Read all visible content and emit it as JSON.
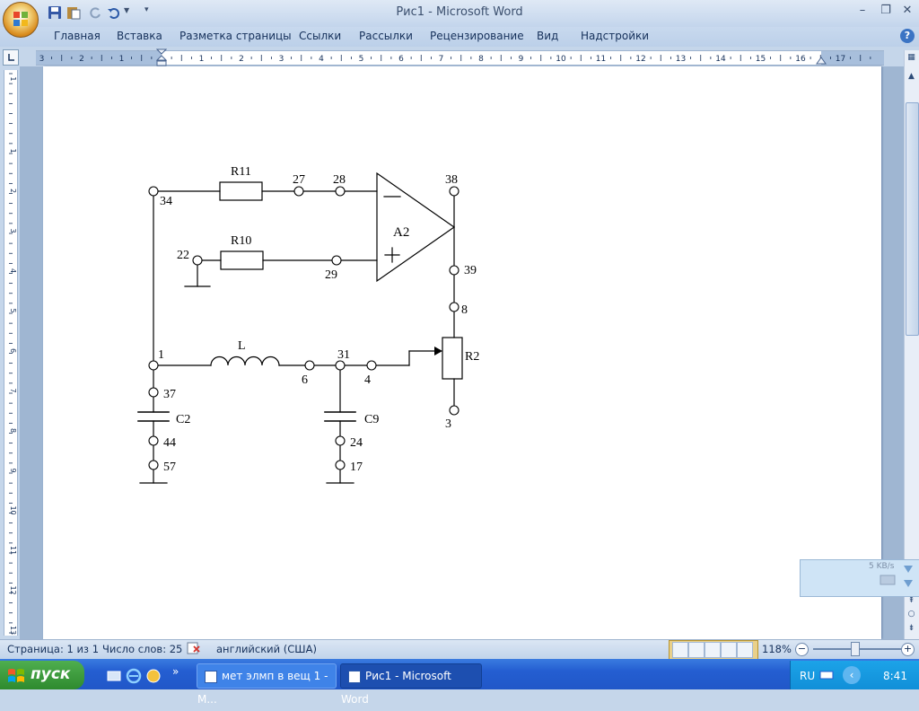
{
  "window": {
    "title": "Рис1 - Microsoft Word"
  },
  "ribbon": {
    "tabs": [
      "Главная",
      "Вставка",
      "Разметка страницы",
      "Ссылки",
      "Рассылки",
      "Рецензирование",
      "Вид",
      "Надстройки"
    ]
  },
  "ruler": {
    "horizontal_numbers": [
      "3",
      "2",
      "1",
      "1",
      "2",
      "3",
      "4",
      "5",
      "6",
      "7",
      "8",
      "9",
      "10",
      "11",
      "12",
      "13",
      "14",
      "15",
      "16",
      "17"
    ],
    "vertical_numbers": [
      "1",
      "1",
      "2",
      "3",
      "4",
      "5",
      "6",
      "7",
      "8",
      "9",
      "10",
      "11",
      "12",
      "13"
    ]
  },
  "diagram": {
    "resistors": [
      "R11",
      "R10",
      "R2"
    ],
    "inductor": "L",
    "capacitors": [
      "C2",
      "C9"
    ],
    "opamp_label": "A2",
    "opamp_inputs": [
      "—",
      "+"
    ],
    "nodes": [
      "34",
      "27",
      "28",
      "38",
      "22",
      "29",
      "39",
      "8",
      "1",
      "6",
      "31",
      "4",
      "3",
      "37",
      "44",
      "57",
      "24",
      "17"
    ]
  },
  "network_widget": {
    "speed": "5 KB/s"
  },
  "statusbar": {
    "page": "Страница: 1 из 1",
    "words": "Число слов: 25",
    "language": "английский (США)",
    "zoom": "118%"
  },
  "taskbar": {
    "start_label": "пуск",
    "tasks": [
      "мет элмп в вещ 1 - М...",
      "Рис1 - Microsoft Word"
    ],
    "tray_language": "RU",
    "clock": "8:41"
  },
  "colors": {
    "ribbon_bg": "#c3d5ec",
    "taskbar": "#245ed1",
    "start_green": "#3a9a3a",
    "tray": "#118fd8"
  }
}
